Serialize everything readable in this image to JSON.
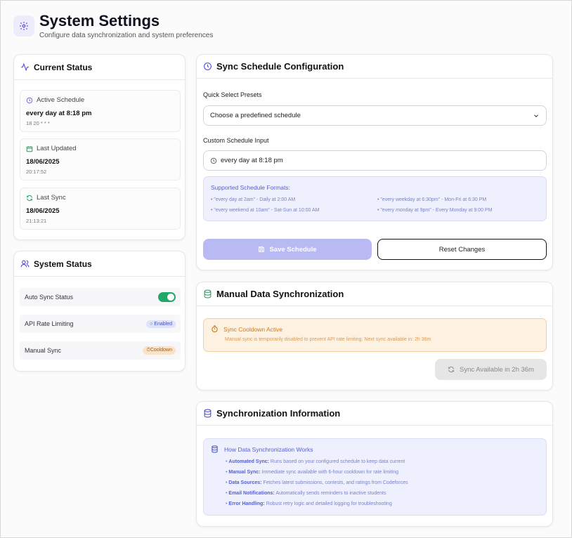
{
  "header": {
    "title": "System Settings",
    "subtitle": "Configure data synchronization and system preferences"
  },
  "current_status": {
    "title": "Current Status",
    "items": [
      {
        "label": "Active Schedule",
        "main": "every day at 8:18 pm",
        "sub": "18 20 * * *",
        "icon": "clock-icon",
        "color": "#6b6ee0"
      },
      {
        "label": "Last Updated",
        "main": "18/06/2025",
        "sub": "20:17:52",
        "icon": "calendar-icon",
        "color": "#22a35a"
      },
      {
        "label": "Last Sync",
        "main": "18/06/2025",
        "sub": "21:13:21",
        "icon": "refresh-icon",
        "color": "#22a35a"
      }
    ]
  },
  "system_status": {
    "title": "System Status",
    "rows": [
      {
        "label": "Auto Sync Status",
        "toggle_on": true
      },
      {
        "label": "API Rate Limiting",
        "badge": "Enabled"
      },
      {
        "label": "Manual Sync",
        "badge": "Cooldown"
      }
    ]
  },
  "schedule": {
    "title": "Sync Schedule Configuration",
    "presets_label": "Quick Select Presets",
    "presets_value": "Choose a predefined schedule",
    "custom_label": "Custom Schedule Input",
    "custom_value": "every day at 8:18 pm",
    "formats_title": "Supported Schedule Formats:",
    "formats": [
      "• \"every day at 2am\" - Daily at 2:00 AM",
      "• \"every weekday at 6:30pm\" - Mon-Fri at 6:30 PM",
      "• \"every weekend at 10am\" - Sat-Sun at 10:00 AM",
      "• \"every monday at 9pm\" - Every Monday at 9:00 PM"
    ],
    "save_label": "Save Schedule",
    "reset_label": "Reset Changes"
  },
  "manual": {
    "title": "Manual Data Synchronization",
    "cooldown_title": "Sync Cooldown Active",
    "cooldown_text": "Manual sync is temporarily disabled to prevent API rate limiting. Next sync available in: 2h 36m",
    "sync_label": "Sync Available in 2h 36m"
  },
  "info": {
    "title": "Synchronization Information",
    "box_title": "How Data Synchronization Works",
    "items": [
      {
        "key": "Automated Sync:",
        "text": "Runs based on your configured schedule to keep data current"
      },
      {
        "key": "Manual Sync:",
        "text": "Immediate sync available with 6-hour cooldown for rate limiting"
      },
      {
        "key": "Data Sources:",
        "text": "Fetches latest submissions, contests, and ratings from Codeforces"
      },
      {
        "key": "Email Notifications:",
        "text": "Automatically sends reminders to inactive students"
      },
      {
        "key": "Error Handling:",
        "text": "Robust retry logic and detailed logging for troubleshooting"
      }
    ]
  },
  "colors": {
    "accent": "#6366f1",
    "success": "#1fa868",
    "warning": "#d07a14"
  }
}
